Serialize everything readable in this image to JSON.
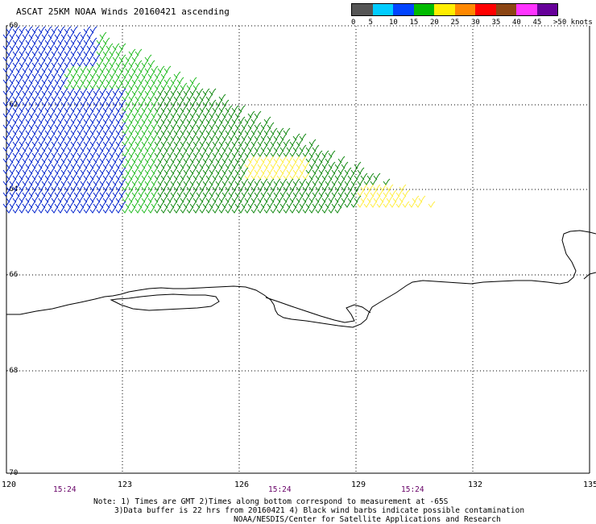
{
  "title": "ASCAT 25KM NOAA Winds 20160421 ascending",
  "legend": {
    "colors": [
      "#555555",
      "#00ccff",
      "#0044ff",
      "#00bb00",
      "#ffee00",
      "#ff8800",
      "#ff0000",
      "#8b4513",
      "#ff33ff",
      "#660099"
    ],
    "labels": [
      "0",
      "5",
      "10",
      "15",
      "20",
      "25",
      "30",
      "35",
      "40",
      "45",
      ">50 knots"
    ]
  },
  "axes": {
    "lon_ticks": [
      "120",
      "123",
      "126",
      "129",
      "132",
      "135"
    ],
    "lat_ticks": [
      "-60",
      "-62",
      "-64",
      "-66",
      "-68",
      "-70"
    ],
    "times": [
      "15:24",
      "15:24",
      "15:24"
    ]
  },
  "notes": {
    "line1": "Note: 1) Times are GMT 2)Times along bottom correspond to measurement at -65S",
    "line2": "3)Data buffer is 22 hrs from 20160421 4) Black wind barbs indicate possible contamination",
    "line3": "NOAA/NESDIS/Center for Satellite Applications and Research"
  },
  "palette": {
    "blue": "#0022cc",
    "green": "#22bb22",
    "dark_green": "#118811",
    "yellow": "#ffee44",
    "time_color": "#660066"
  }
}
